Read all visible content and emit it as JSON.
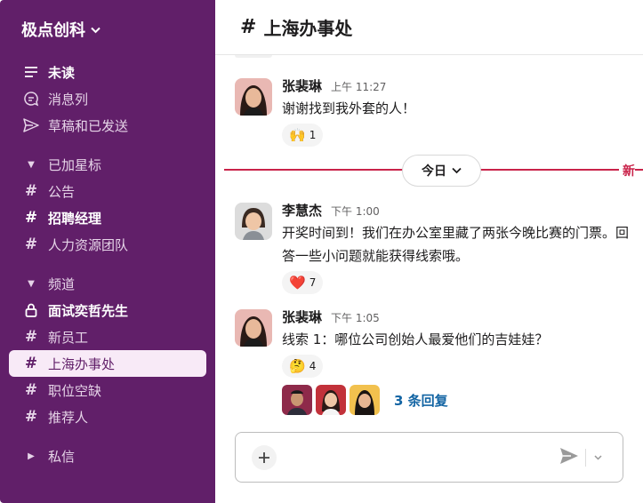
{
  "workspace": {
    "name": "极点创科"
  },
  "sidebar": {
    "top_items": [
      {
        "label": "未读",
        "icon": "unread-icon"
      },
      {
        "label": "消息列",
        "icon": "threads-icon"
      },
      {
        "label": "草稿和已发送",
        "icon": "send-icon"
      }
    ],
    "starred_header": "已加星标",
    "starred": [
      {
        "label": "公告"
      },
      {
        "label": "招聘经理"
      },
      {
        "label": "人力资源团队"
      }
    ],
    "channels_header": "频道",
    "channels": [
      {
        "label": "面试奕哲先生",
        "icon": "lock-icon"
      },
      {
        "label": "新员工"
      },
      {
        "label": "上海办事处"
      },
      {
        "label": "职位空缺"
      },
      {
        "label": "推荐人"
      }
    ],
    "dm_header": "私信"
  },
  "channel": {
    "name": "上海办事处"
  },
  "messages": [
    {
      "sender": "张裴琳",
      "time": "上午 11:27",
      "text": "谢谢找到我外套的人！",
      "reaction": {
        "emoji": "🙌",
        "count": "1"
      }
    },
    {
      "sender": "李慧杰",
      "time": "下午 1:00",
      "text": "开奖时间到！我们在办公室里藏了两张今晚比赛的门票。回答一些小问题就能获得线索哦。",
      "reaction": {
        "emoji": "❤️",
        "count": "7"
      }
    },
    {
      "sender": "张裴琳",
      "time": "下午 1:05",
      "text": "线索 1：哪位公司创始人最爱他们的吉娃娃？",
      "reaction": {
        "emoji": "🤔",
        "count": "4"
      },
      "replies": "3 条回复"
    }
  ],
  "divider": {
    "day": "今日",
    "new_label": "新"
  },
  "composer": {
    "placeholder": ""
  },
  "colors": {
    "sidebar": "#611f69",
    "accent_new": "#c9234a",
    "link": "#1264a3"
  }
}
